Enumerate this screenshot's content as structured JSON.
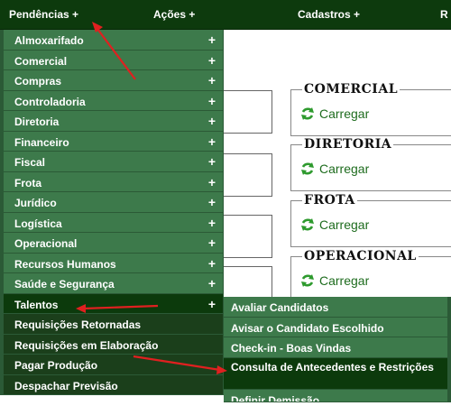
{
  "top_menu": {
    "pendencias": "Pendências +",
    "acoes": "Ações +",
    "cadastros": "Cadastros +",
    "cut": "R"
  },
  "menu": {
    "items": [
      {
        "label": "Almoxarifado",
        "plus": "+"
      },
      {
        "label": "Comercial",
        "plus": "+"
      },
      {
        "label": "Compras",
        "plus": "+"
      },
      {
        "label": "Controladoria",
        "plus": "+"
      },
      {
        "label": "Diretoria",
        "plus": "+"
      },
      {
        "label": "Financeiro",
        "plus": "+"
      },
      {
        "label": "Fiscal",
        "plus": "+"
      },
      {
        "label": "Frota",
        "plus": "+"
      },
      {
        "label": "Jurídico",
        "plus": "+"
      },
      {
        "label": "Logística",
        "plus": "+"
      },
      {
        "label": "Operacional",
        "plus": "+"
      },
      {
        "label": "Recursos Humanos",
        "plus": "+"
      },
      {
        "label": "Saúde e Segurança",
        "plus": "+"
      },
      {
        "label": "Talentos",
        "plus": "+"
      },
      {
        "label": "Requisições Retornadas"
      },
      {
        "label": "Requisições em Elaboração"
      },
      {
        "label": "Pagar Produção"
      },
      {
        "label": "Despachar Previsão"
      }
    ]
  },
  "submenu": {
    "items": [
      "Avaliar Candidatos",
      "Avisar o Candidato Escolhido",
      "Check-in - Boas Vindas",
      "Consulta de Antecedentes e Restrições",
      "Definir Demissão"
    ]
  },
  "panels": [
    {
      "legend": "COMERCIAL",
      "action": "Carregar"
    },
    {
      "legend": "DIRETORIA",
      "action": "Carregar"
    },
    {
      "legend": "FROTA",
      "action": "Carregar"
    },
    {
      "legend": "OPERACIONAL",
      "action": "Carregar"
    }
  ],
  "colors": {
    "topbar": "#0d3a0d",
    "menu": "#3d7a4b",
    "menu_active": "#0c3a0c",
    "carregar": "#1e6c1e",
    "arrow": "#e02020"
  }
}
